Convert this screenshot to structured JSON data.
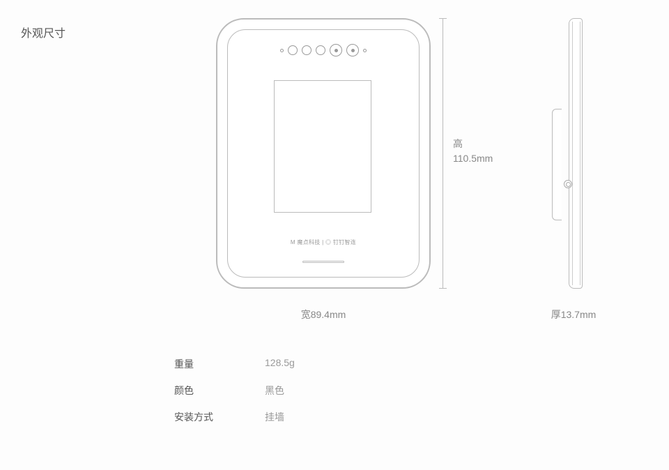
{
  "section_title": "外观尺寸",
  "dimensions": {
    "width_label": "宽89.4mm",
    "height_label_1": "高",
    "height_label_2": "110.5mm",
    "depth_label": "厚13.7mm"
  },
  "device_logo": "M 魔点科技 | ◎ 钉钉智连",
  "specs": [
    {
      "label": "重量",
      "value": "128.5g"
    },
    {
      "label": "颜色",
      "value": "黑色"
    },
    {
      "label": "安装方式",
      "value": "挂墙"
    }
  ]
}
